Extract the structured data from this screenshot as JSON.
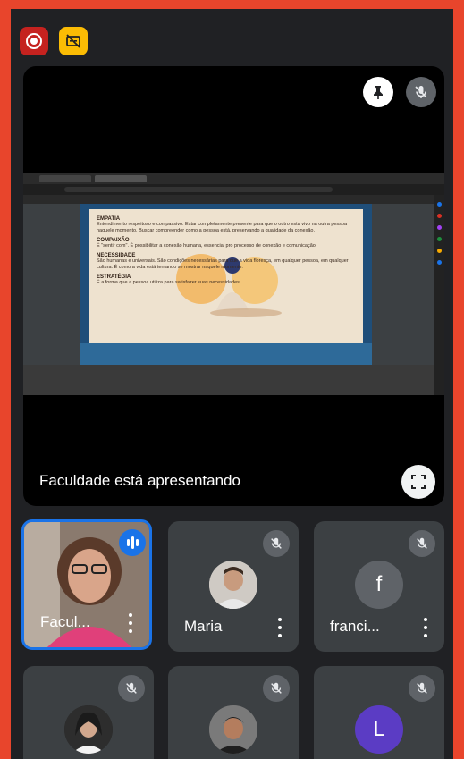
{
  "topbar": {
    "icons": [
      "record-icon",
      "captions-off-icon"
    ]
  },
  "stage": {
    "presenter_label": "Faculdade está apresentando",
    "icons": [
      "pin-icon",
      "mic-off-icon",
      "fullscreen-icon"
    ]
  },
  "participants": [
    {
      "name": "Facul...",
      "type": "camera",
      "speaking": true
    },
    {
      "name": "Maria",
      "type": "photo",
      "muted": true
    },
    {
      "name": "franci...",
      "type": "initial",
      "initial": "f",
      "color": "#5f6368",
      "muted": true
    },
    {
      "name": "",
      "type": "photo",
      "muted": true
    },
    {
      "name": "",
      "type": "photo",
      "muted": true
    },
    {
      "name": "",
      "type": "initial",
      "initial": "L",
      "color": "#5b3cc4",
      "muted": true
    }
  ],
  "colors": {
    "frame": "#e8452c",
    "record": "#c5221f",
    "captions": "#fbbc04",
    "active_border": "#1a73e8"
  }
}
